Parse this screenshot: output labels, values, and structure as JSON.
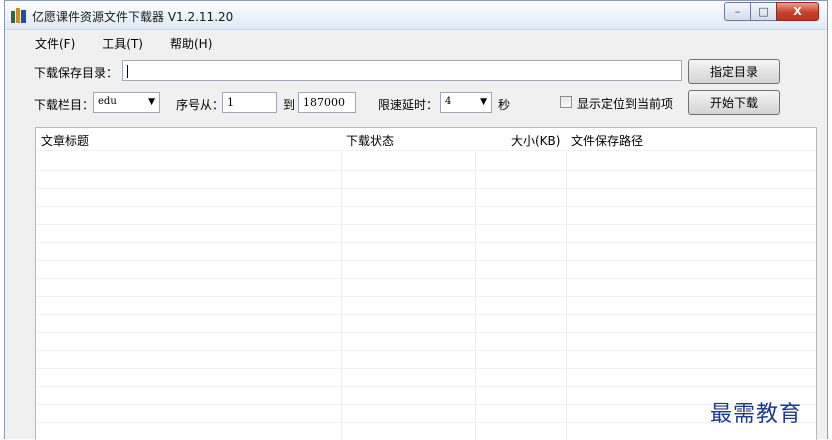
{
  "window": {
    "title": "亿愿课件资源文件下载器 V1.2.11.20",
    "controls": {
      "minimize": "–",
      "maximize": "□",
      "close": "X"
    }
  },
  "menu": [
    "文件(F)",
    "工具(T)",
    "帮助(H)"
  ],
  "download_dir": {
    "label": "下载保存目录：",
    "value": "",
    "button": "指定目录"
  },
  "filters": {
    "column_label": "下载栏目：",
    "column_value": "edu",
    "seq_from_label": "序号从：",
    "seq_from_value": "1",
    "seq_to_label": "到",
    "seq_to_value": "187000",
    "delay_label": "限速延时：",
    "delay_value": "4",
    "delay_unit": "秒",
    "locate_checkbox_label": "显示定位到当前项",
    "locate_checked": false,
    "start_button": "开始下载"
  },
  "table": {
    "columns": [
      "文章标题",
      "下载状态",
      "大小(KB)",
      "文件保存路径"
    ],
    "rows": []
  },
  "watermark": "最需教育"
}
